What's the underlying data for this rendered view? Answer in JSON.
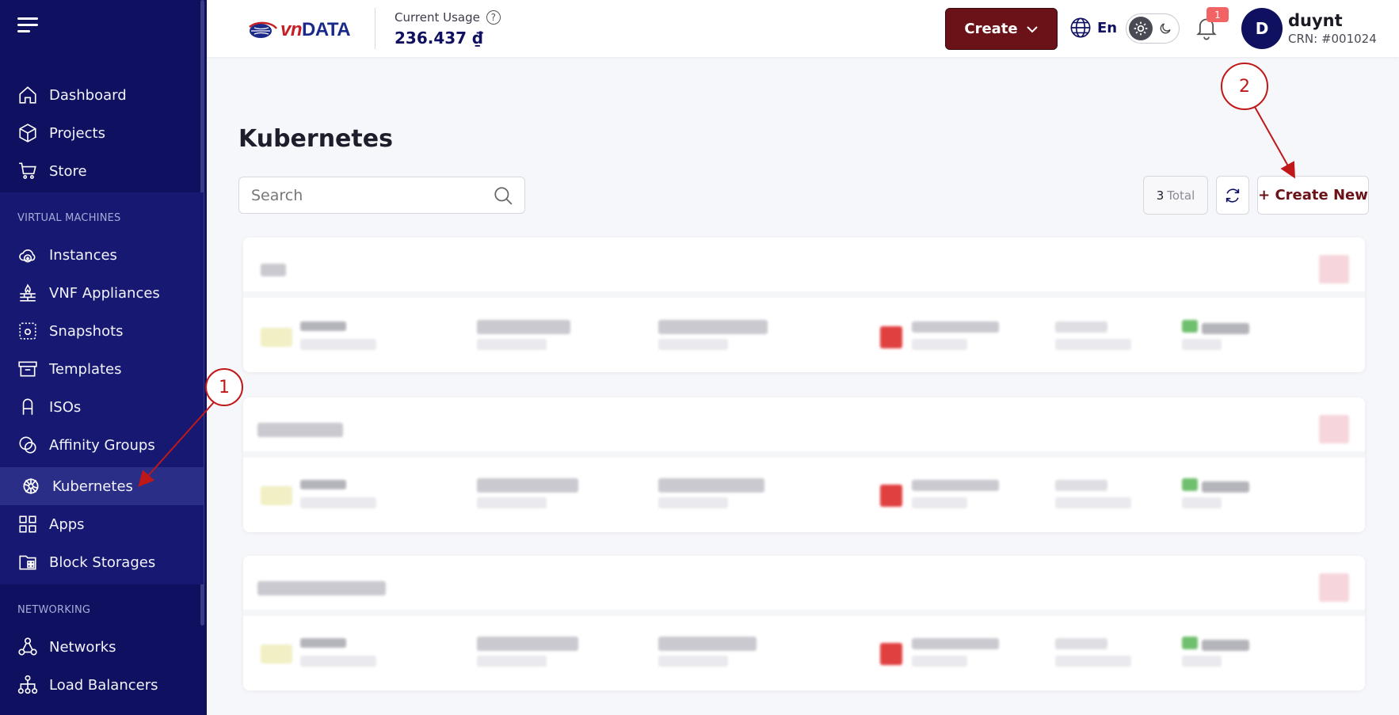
{
  "sidebar": {
    "main_items": [
      {
        "label": "Dashboard",
        "icon": "home-icon"
      },
      {
        "label": "Projects",
        "icon": "cube-icon"
      },
      {
        "label": "Store",
        "icon": "cart-icon"
      }
    ],
    "sections": [
      {
        "title": "VIRTUAL MACHINES",
        "items": [
          {
            "label": "Instances",
            "icon": "cloud-plus-icon"
          },
          {
            "label": "VNF Appliances",
            "icon": "firewall-icon"
          },
          {
            "label": "Snapshots",
            "icon": "snapshot-icon"
          },
          {
            "label": "Templates",
            "icon": "archive-icon"
          },
          {
            "label": "ISOs",
            "icon": "iso-icon"
          },
          {
            "label": "Affinity Groups",
            "icon": "affinity-icon"
          },
          {
            "label": "Kubernetes",
            "icon": "kubernetes-icon",
            "active": true
          },
          {
            "label": "Apps",
            "icon": "apps-grid-icon"
          },
          {
            "label": "Block Storages",
            "icon": "block-storage-icon"
          }
        ]
      },
      {
        "title": "NETWORKING",
        "items": [
          {
            "label": "Networks",
            "icon": "network-icon"
          },
          {
            "label": "Load Balancers",
            "icon": "load-balancer-icon"
          }
        ]
      }
    ]
  },
  "topbar": {
    "logo_prefix": "vn",
    "logo_suffix": "DATA",
    "usage_label": "Current Usage",
    "usage_value": "236.437 ₫",
    "create_label": "Create",
    "language": "En",
    "notification_count": "1",
    "avatar_initial": "D",
    "user_name": "duynt",
    "user_crn": "CRN: #001024"
  },
  "main": {
    "title": "Kubernetes",
    "search_placeholder": "Search",
    "total_count": "3",
    "total_label": "Total",
    "create_new_label": "+ Create New",
    "clusters_count": 3
  },
  "annotations": [
    "1",
    "2"
  ],
  "colors": {
    "sidebar_bg": "#0f1160",
    "brand_dark_red": "#6b1218",
    "annotation_red": "#c01818",
    "badge_red": "#f26464"
  }
}
